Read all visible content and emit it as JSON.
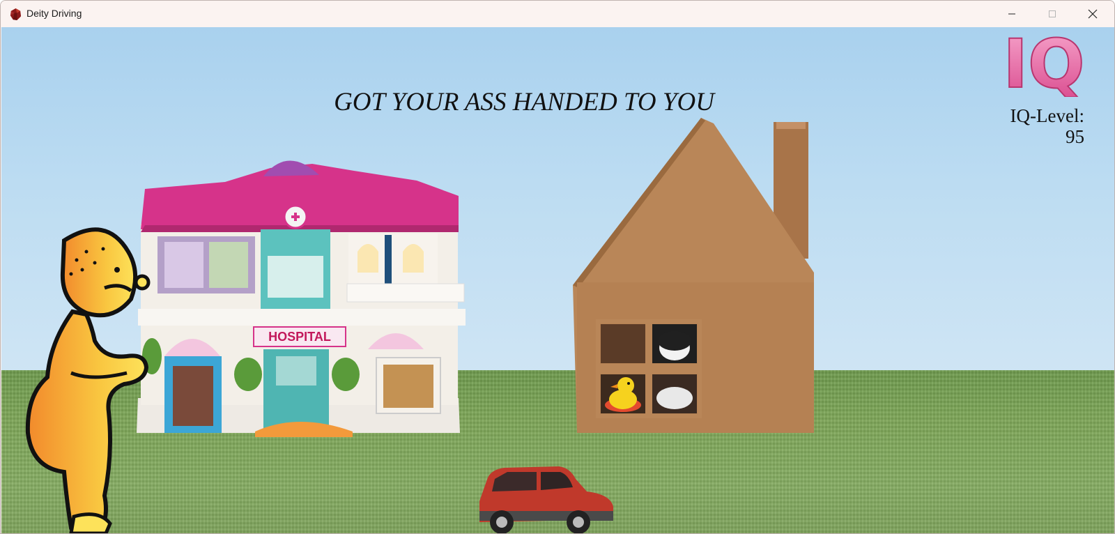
{
  "window": {
    "title": "Deity Driving",
    "icon": "red-gem-icon",
    "controls": {
      "minimize": "minimize-icon",
      "maximize": "maximize-icon",
      "close": "close-icon"
    }
  },
  "hud": {
    "iq_logo_text": "IQ",
    "iq_label": "IQ-Level:",
    "iq_value": "95"
  },
  "message": "GOT YOUR ASS HANDED TO YOU",
  "scene": {
    "hospital_sign": "HOSPITAL",
    "objects": [
      "toy-hospital",
      "cardboard-house",
      "yellow-cartoon-character",
      "red-toy-car",
      "rubber-duck"
    ],
    "colors": {
      "sky": "#bcdcf2",
      "grass": "#7ea758",
      "hospital_roof": "#d6338a",
      "cardboard": "#b98658",
      "car": "#c0392b",
      "logo": "#e66aa8"
    }
  }
}
